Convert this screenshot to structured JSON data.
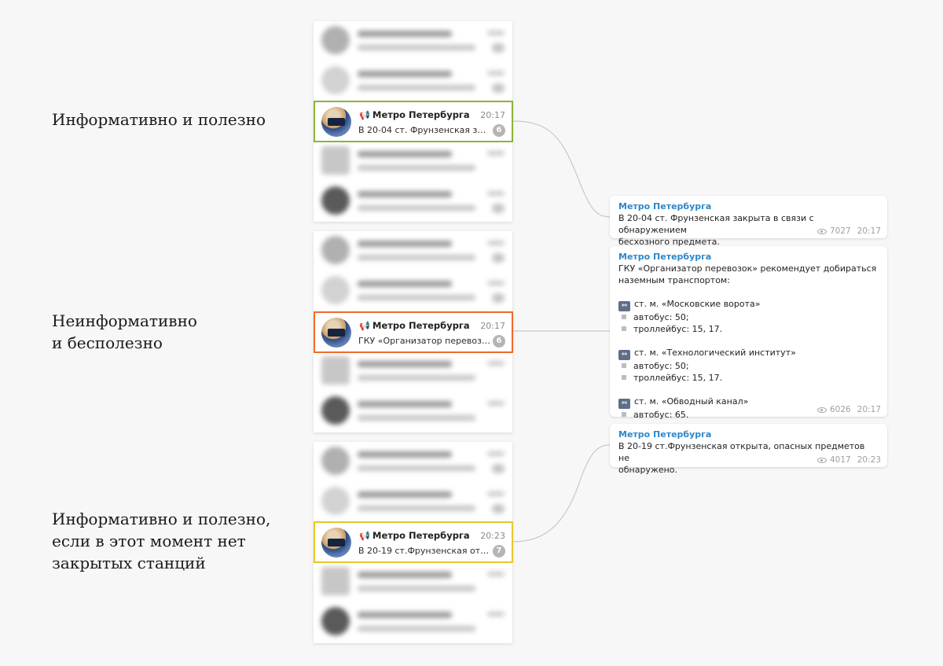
{
  "captions": [
    {
      "lines": [
        "Информативно и полезно"
      ]
    },
    {
      "lines": [
        "Неинформативно",
        "и бесполезно"
      ]
    },
    {
      "lines": [
        "Информативно и полезно,",
        "если в этот момент нет",
        "закрытых станций"
      ]
    }
  ],
  "colors": {
    "green": "#8cb23a",
    "orange": "#ee6a2b",
    "yellow": "#e8c72b",
    "author": "#2d87c8"
  },
  "chats": [
    {
      "name": "Метро Петербурга",
      "time": "20:17",
      "preview": "В 20-04 ст. Фрунзенская закрыта в связи с обнаружением бесхозного предмета.",
      "unread": "6"
    },
    {
      "name": "Метро Петербурга",
      "time": "20:17",
      "preview": "ГКУ «Организатор перевозок» рекомендует добираться наземным транспортом:",
      "unread": "6"
    },
    {
      "name": "Метро Петербурга",
      "time": "20:23",
      "preview": "В 20-19 ст.Фрунзенская открыта, опасных предметов не обнаружено.",
      "unread": "7"
    }
  ],
  "messages": [
    {
      "author": "Метро Петербурга",
      "lines": [
        "В 20-04 ст. Фрунзенская закрыта в связи с обнаружением",
        "бесхозного предмета."
      ],
      "views": "7027",
      "time": "20:17"
    },
    {
      "author": "Метро Петербурга",
      "intro": [
        "ГКУ «Организатор перевозок» рекомендует добираться",
        "наземным транспортом:"
      ],
      "stations": [
        {
          "name": "ст. м. «Московские ворота»",
          "routes": [
            "автобус: 50;",
            "троллейбус: 15, 17."
          ]
        },
        {
          "name": "ст. м. «Технологический институт»",
          "routes": [
            "автобус: 50;",
            "троллейбус: 15, 17."
          ]
        },
        {
          "name": "ст. м. «Обводный канал»",
          "routes": [
            "автобус: 65."
          ]
        }
      ],
      "views": "6026",
      "time": "20:17"
    },
    {
      "author": "Метро Петербурга",
      "lines": [
        "В 20-19 ст.Фрунзенская открыта, опасных предметов не",
        "обнаружено."
      ],
      "views": "4017",
      "time": "20:23"
    }
  ]
}
